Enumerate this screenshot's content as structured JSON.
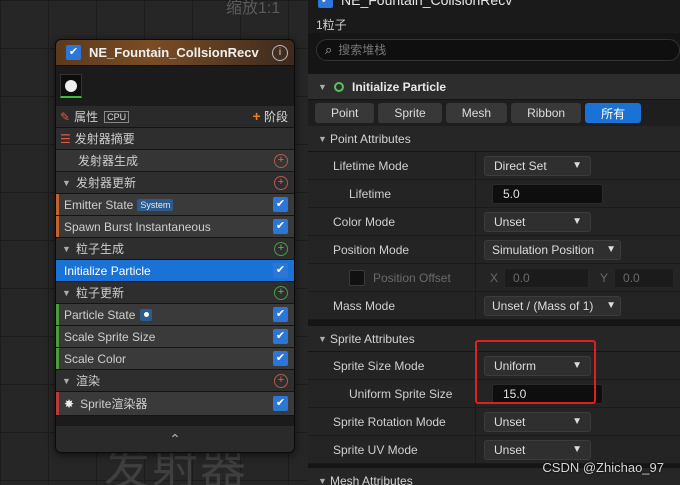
{
  "graph": {
    "zoom_label": "缩放1:1",
    "watermark_text": "发射器"
  },
  "node": {
    "title": "NE_Fountain_CollsionRecv",
    "info_icon": "info-icon",
    "properties_label": "属性",
    "cpu_label": "CPU",
    "add_stage_label": "阶段",
    "rows": {
      "emitter_summary": "发射器摘要",
      "emitter_spawn": "发射器生成",
      "emitter_update": "发射器更新",
      "emitter_state": "Emitter State",
      "system_badge": "System",
      "spawn_burst": "Spawn Burst Instantaneous",
      "particle_spawn": "粒子生成",
      "initialize_particle": "Initialize Particle",
      "particle_update": "粒子更新",
      "particle_state": "Particle State",
      "scale_sprite_size": "Scale Sprite Size",
      "scale_color": "Scale Color",
      "render": "渲染",
      "sprite_renderer": "Sprite渲染器"
    },
    "colors": {
      "accent": "#1a72d6",
      "header": "#7a4d25",
      "add_red": "#d46a58",
      "add_green": "#5fbf5f"
    }
  },
  "panel": {
    "title": "NE_Fountain_CollsionRecv",
    "particle_count": "1粒子",
    "search_placeholder": "搜索堆栈",
    "section_title": "Initialize Particle",
    "tabs": [
      "Point",
      "Sprite",
      "Mesh",
      "Ribbon",
      "所有"
    ],
    "active_tab": "所有",
    "point_attributes": {
      "header": "Point Attributes",
      "lifetime_mode_label": "Lifetime Mode",
      "lifetime_mode_value": "Direct Set",
      "lifetime_label": "Lifetime",
      "lifetime_value": "5.0",
      "color_mode_label": "Color Mode",
      "color_mode_value": "Unset",
      "position_mode_label": "Position Mode",
      "position_mode_value": "Simulation Position",
      "position_offset_label": "Position Offset",
      "x_label": "X",
      "x_value": "0.0",
      "y_label": "Y",
      "y_value": "0.0",
      "mass_mode_label": "Mass Mode",
      "mass_mode_value": "Unset / (Mass of 1)"
    },
    "sprite_attributes": {
      "header": "Sprite Attributes",
      "size_mode_label": "Sprite Size Mode",
      "size_mode_value": "Uniform",
      "uniform_size_label": "Uniform Sprite Size",
      "uniform_size_value": "15.0",
      "rotation_mode_label": "Sprite Rotation Mode",
      "rotation_mode_value": "Unset",
      "uv_mode_label": "Sprite UV Mode",
      "uv_mode_value": "Unset"
    },
    "mesh_attributes": {
      "header": "Mesh Attributes"
    }
  },
  "watermark": "CSDN @Zhichao_97"
}
